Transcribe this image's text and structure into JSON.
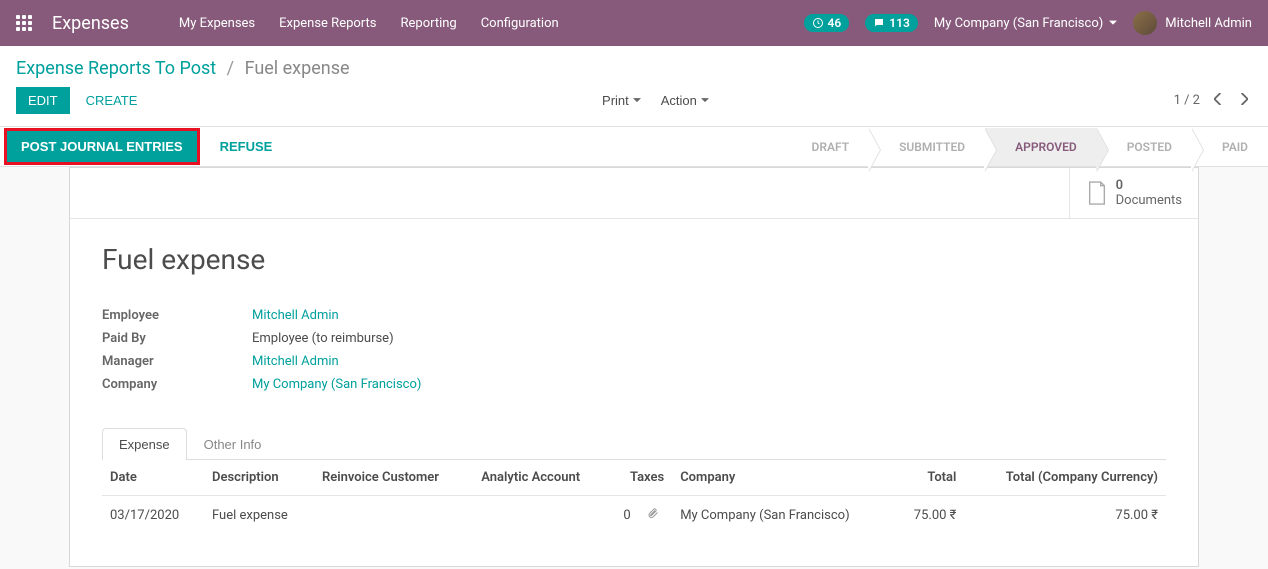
{
  "navbar": {
    "app_title": "Expenses",
    "menu": [
      "My Expenses",
      "Expense Reports",
      "Reporting",
      "Configuration"
    ],
    "activity_count": "46",
    "message_count": "113",
    "company": "My Company (San Francisco)",
    "user": "Mitchell Admin"
  },
  "breadcrumb": {
    "parent": "Expense Reports To Post",
    "current": "Fuel expense"
  },
  "toolbar": {
    "edit": "Edit",
    "create": "Create",
    "print": "Print",
    "action": "Action",
    "pager": "1 / 2"
  },
  "actions": {
    "post": "Post Journal Entries",
    "refuse": "Refuse",
    "statuses": [
      "DRAFT",
      "SUBMITTED",
      "APPROVED",
      "POSTED",
      "PAID"
    ],
    "active_status": "APPROVED"
  },
  "documents": {
    "count": "0",
    "label": "Documents"
  },
  "record": {
    "title": "Fuel expense",
    "fields": {
      "employee_label": "Employee",
      "employee_value": "Mitchell Admin",
      "paid_by_label": "Paid By",
      "paid_by_value": "Employee (to reimburse)",
      "manager_label": "Manager",
      "manager_value": "Mitchell Admin",
      "company_label": "Company",
      "company_value": "My Company (San Francisco)"
    }
  },
  "tabs": {
    "expense": "Expense",
    "other_info": "Other Info"
  },
  "table": {
    "headers": {
      "date": "Date",
      "description": "Description",
      "reinvoice": "Reinvoice Customer",
      "analytic": "Analytic Account",
      "taxes": "Taxes",
      "company": "Company",
      "total": "Total",
      "total_cc": "Total (Company Currency)"
    },
    "rows": [
      {
        "date": "03/17/2020",
        "description": "Fuel expense",
        "attachment_count": "0",
        "company": "My Company (San Francisco)",
        "total": "75.00 ₹",
        "total_cc": "75.00 ₹"
      }
    ]
  }
}
